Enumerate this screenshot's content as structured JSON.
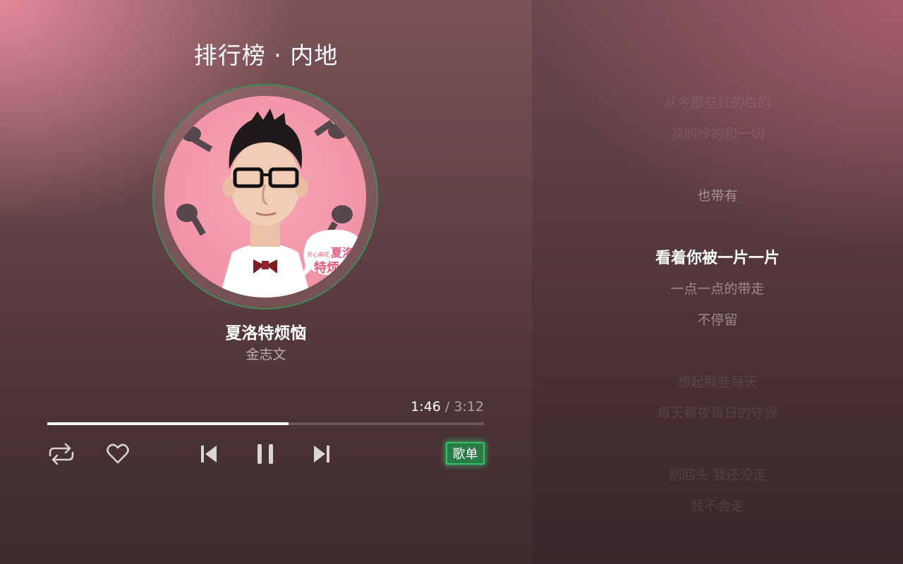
{
  "header": {
    "title": "排行榜 · 内地"
  },
  "track": {
    "title": "夏洛特烦恼",
    "artist": "金志文",
    "cover_icon": "album-cover-portrait",
    "cover_text": [
      "开心麻花",
      "夏洛",
      "特烦"
    ]
  },
  "playback": {
    "current_time": "1:46",
    "separator": " / ",
    "total_time": "3:12",
    "progress": 0.553
  },
  "controls": {
    "repeat_icon": "repeat-icon",
    "favorite_icon": "heart-icon",
    "previous_icon": "skip-previous-icon",
    "pause_icon": "pause-icon",
    "next_icon": "skip-next-icon",
    "playlist_label": "歌单"
  },
  "lyrics": [
    {
      "text": "从今那些红的白的",
      "state": "faint"
    },
    {
      "text": "灰的冷的和一切",
      "state": "faint"
    },
    {
      "text": "也带有",
      "state": "dim"
    },
    {
      "text": "看着你被一片一片",
      "state": "current"
    },
    {
      "text": "一点一点的带走",
      "state": "dim"
    },
    {
      "text": "不停留",
      "state": "dim"
    },
    {
      "text": "想起那些每天",
      "state": "faint"
    },
    {
      "text": "每天每夜每日的守候",
      "state": "faint"
    },
    {
      "text": "别回头 我还没走",
      "state": "faint"
    },
    {
      "text": "我不会走",
      "state": "faint"
    }
  ],
  "colors": {
    "accent": "#2ec46a",
    "progress_fill": "#ffffff",
    "cover_background": "#f193a6"
  }
}
